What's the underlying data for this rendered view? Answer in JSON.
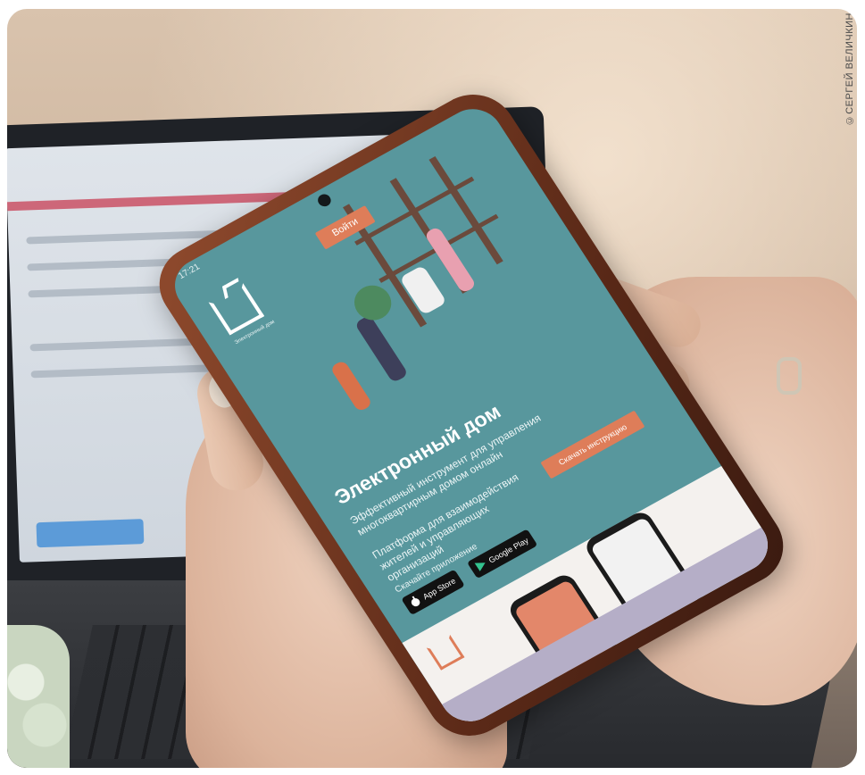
{
  "photo_credit": "©СЕРГЕЙ ВЕЛИЧКИН",
  "phone_app": {
    "status_time": "17:21",
    "logo_caption": "Электронный дом",
    "login_label": "Войти",
    "title": "Электронный дом",
    "subtitle": "Эффективный инструмент для управления многоквартирным домом онлайн",
    "description": "Платформа для взаимодействия жителей и управляющих организаций",
    "download_instructions_label": "Скачать инструкцию",
    "download_app_label": "Скачайте приложение",
    "app_store_label": "App Store",
    "google_play_label": "Google Play"
  },
  "colors": {
    "screen_teal": "#58979d",
    "accent_orange": "#de7d59",
    "phone_case": "#7a3a22"
  }
}
